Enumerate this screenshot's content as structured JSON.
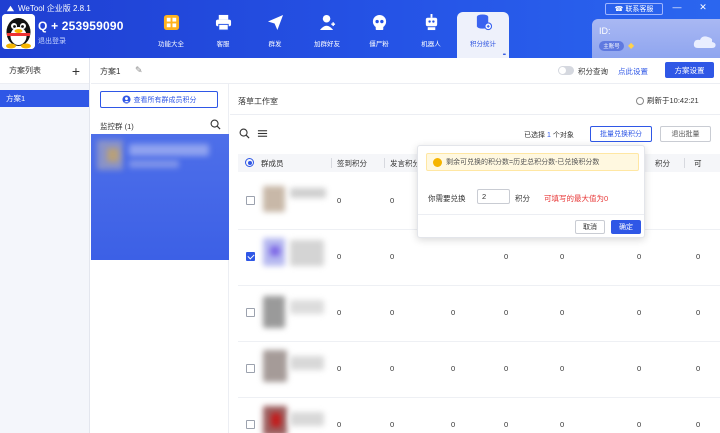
{
  "app": {
    "title": "WeTool 企业版 2.8.1"
  },
  "account": {
    "id": "Q + 253959090",
    "logout": "退出登录"
  },
  "nav": [
    {
      "label": "功能大全",
      "icon": "grid-icon"
    },
    {
      "label": "客服",
      "icon": "printer-icon"
    },
    {
      "label": "群发",
      "icon": "send-icon"
    },
    {
      "label": "加群好友",
      "icon": "add-user-icon"
    },
    {
      "label": "僵尸粉",
      "icon": "skull-icon"
    },
    {
      "label": "机器人",
      "icon": "robot-icon"
    },
    {
      "label": "积分统计",
      "icon": "database-icon",
      "active": true
    }
  ],
  "titlebar": {
    "contact_support": "联系客服"
  },
  "id_card": {
    "label": "ID:",
    "badge": "主账号"
  },
  "left": {
    "title": "方案列表",
    "items": [
      "方案1"
    ]
  },
  "toolbar": {
    "scheme_name": "方案1",
    "points_query": "积分查询",
    "points_query_link": "点此设置",
    "scheme_settings": "方案设置"
  },
  "groups": {
    "view_all": "查看所有群成员积分",
    "monitor_label": "监控群",
    "monitor_count": "(1)"
  },
  "workspace": {
    "title": "落草工作室",
    "refresh": "刷新于10:42:21",
    "selected_prefix": "已选择",
    "selected_count": "1",
    "selected_suffix": "个对象",
    "bulk_redeem": "批量兑换积分",
    "exit_bulk": "退出批量"
  },
  "table": {
    "headers": [
      "群成员",
      "签到积分",
      "发言积分",
      "积分",
      "可"
    ],
    "rows": [
      {
        "checked": false,
        "values": [
          "0",
          "0",
          "0",
          "0",
          "0",
          "0",
          "0"
        ]
      },
      {
        "checked": true,
        "values": [
          "0",
          "0",
          "0",
          "0",
          "0",
          "0",
          "0"
        ]
      },
      {
        "checked": false,
        "values": [
          "0",
          "0",
          "0",
          "0",
          "0",
          "0",
          "0"
        ]
      },
      {
        "checked": false,
        "values": [
          "0",
          "0",
          "0",
          "0",
          "0",
          "0",
          "0"
        ]
      },
      {
        "checked": false,
        "values": [
          "0",
          "0",
          "0",
          "0",
          "0",
          "0",
          "0"
        ]
      }
    ]
  },
  "popover": {
    "tip": "剩余可兑换的积分数=历史总积分数-已兑换积分数",
    "label": "你需要兑换",
    "value": "2",
    "unit": "积分",
    "max_hint": "可填写的最大值为0",
    "cancel": "取消",
    "confirm": "确定"
  },
  "colors": {
    "primary": "#2f57e6",
    "danger": "#e83a3a",
    "warning": "#f5b400"
  }
}
